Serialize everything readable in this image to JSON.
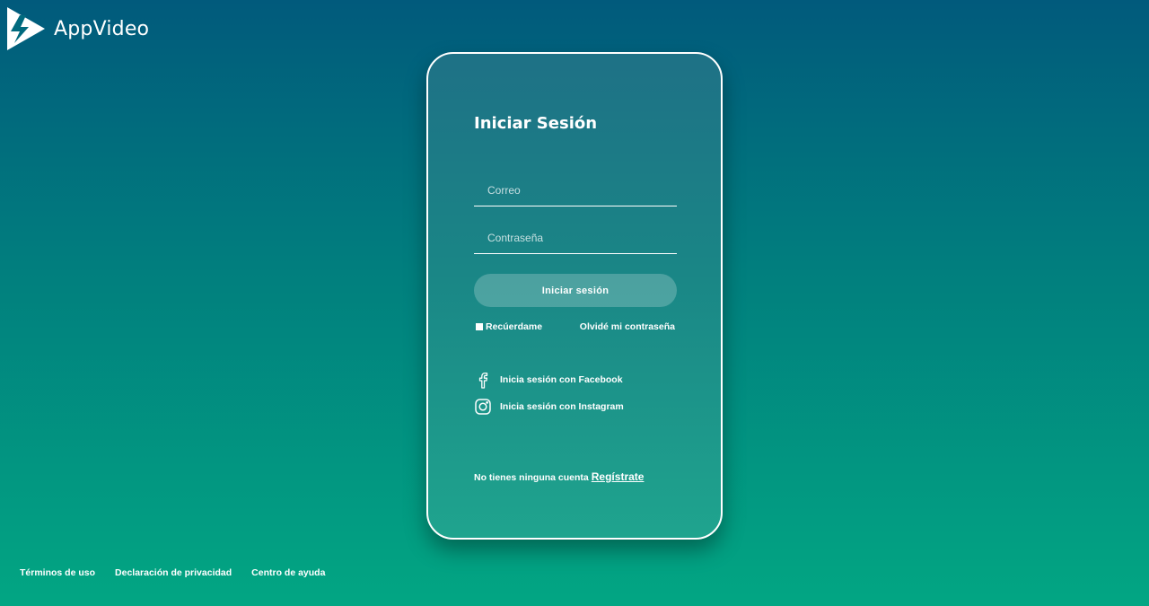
{
  "header": {
    "app_name": "AppVideo",
    "logo_icon": "play-bolt-logo-icon"
  },
  "login": {
    "title": "Iniciar Sesión",
    "email_placeholder": "Correo",
    "email_value": "",
    "password_placeholder": "Contraseña",
    "password_value": "",
    "submit_label": "Iniciar sesión",
    "remember_label": "Recúerdame",
    "forgot_label": "Olvidé mi contraseña",
    "social": [
      {
        "label": "Inicia sesión con Facebook",
        "icon": "facebook-icon"
      },
      {
        "label": "Inicia sesión con Instagram",
        "icon": "instagram-icon"
      }
    ],
    "no_account_text": "No tienes ninguna cuenta",
    "register_label": "Regístrate"
  },
  "footer": {
    "links": [
      "Términos de uso",
      "Declaración de privacidad",
      "Centro de ayuda"
    ]
  },
  "colors": {
    "background_top": "#015a7c",
    "background_bottom": "#02a683",
    "card_border": "#ffffff",
    "text": "#ffffff"
  }
}
